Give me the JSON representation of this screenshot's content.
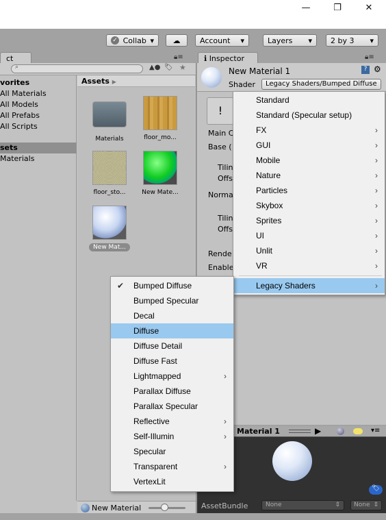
{
  "window": {
    "minimize": "—",
    "maximize": "❐",
    "close": "✕"
  },
  "toolbar": {
    "collab": "Collab",
    "account": "Account",
    "layers": "Layers",
    "layout": "2 by 3"
  },
  "project": {
    "tab": "ct",
    "search_placeholder": "",
    "tree": [
      {
        "label": "vorites",
        "bold": true
      },
      {
        "label": "All Materials"
      },
      {
        "label": "All Models"
      },
      {
        "label": "All Prefabs"
      },
      {
        "label": "All Scripts"
      },
      {
        "label": "sets",
        "bold": true,
        "selected": true
      },
      {
        "label": "Materials"
      }
    ],
    "breadcrumb": "Assets",
    "assets": [
      {
        "name": "Materials",
        "kind": "folder"
      },
      {
        "name": "floor_mo...",
        "kind": "wood"
      },
      {
        "name": "floor_sto...",
        "kind": "stone"
      },
      {
        "name": "New Mate...",
        "kind": "green-sphere"
      },
      {
        "name": "New Mat...",
        "kind": "white-sphere",
        "selected": true
      }
    ],
    "footer": "New Material"
  },
  "inspector": {
    "tab": "Inspector",
    "material_name": "New Material 1",
    "shader_label": "Shader",
    "shader_value": "Legacy Shaders/Bumped Diffuse",
    "props": [
      "Main C",
      "Base (",
      "Tilin",
      "Offs",
      "Norma",
      "Tilin",
      "Offs",
      "Rende",
      "Enable"
    ]
  },
  "shader_menu": {
    "items": [
      {
        "label": "Standard",
        "sub": false
      },
      {
        "label": "Standard (Specular setup)",
        "sub": false
      },
      {
        "label": "FX",
        "sub": true
      },
      {
        "label": "GUI",
        "sub": true
      },
      {
        "label": "Mobile",
        "sub": true
      },
      {
        "label": "Nature",
        "sub": true
      },
      {
        "label": "Particles",
        "sub": true
      },
      {
        "label": "Skybox",
        "sub": true
      },
      {
        "label": "Sprites",
        "sub": true
      },
      {
        "label": "UI",
        "sub": true
      },
      {
        "label": "Unlit",
        "sub": true
      },
      {
        "label": "VR",
        "sub": true
      },
      {
        "label": "Legacy Shaders",
        "sub": true,
        "highlighted": true
      }
    ]
  },
  "legacy_menu": {
    "items": [
      {
        "label": "Bumped Diffuse",
        "checked": true
      },
      {
        "label": "Bumped Specular"
      },
      {
        "label": "Decal"
      },
      {
        "label": "Diffuse",
        "highlighted": true
      },
      {
        "label": "Diffuse Detail"
      },
      {
        "label": "Diffuse Fast"
      },
      {
        "label": "Lightmapped",
        "sub": true
      },
      {
        "label": "Parallax Diffuse"
      },
      {
        "label": "Parallax Specular"
      },
      {
        "label": "Reflective",
        "sub": true
      },
      {
        "label": "Self-Illumin",
        "sub": true
      },
      {
        "label": "Specular"
      },
      {
        "label": "Transparent",
        "sub": true
      },
      {
        "label": "VertexLit"
      }
    ]
  },
  "preview": {
    "title": "Material 1",
    "assetbundle_label": "AssetBundle",
    "bundle_value": "None",
    "variant_value": "None"
  },
  "colors": {
    "highlight": "#99c9ef",
    "preview_bg": "#313131",
    "tag_badge": "#2a66c8"
  }
}
